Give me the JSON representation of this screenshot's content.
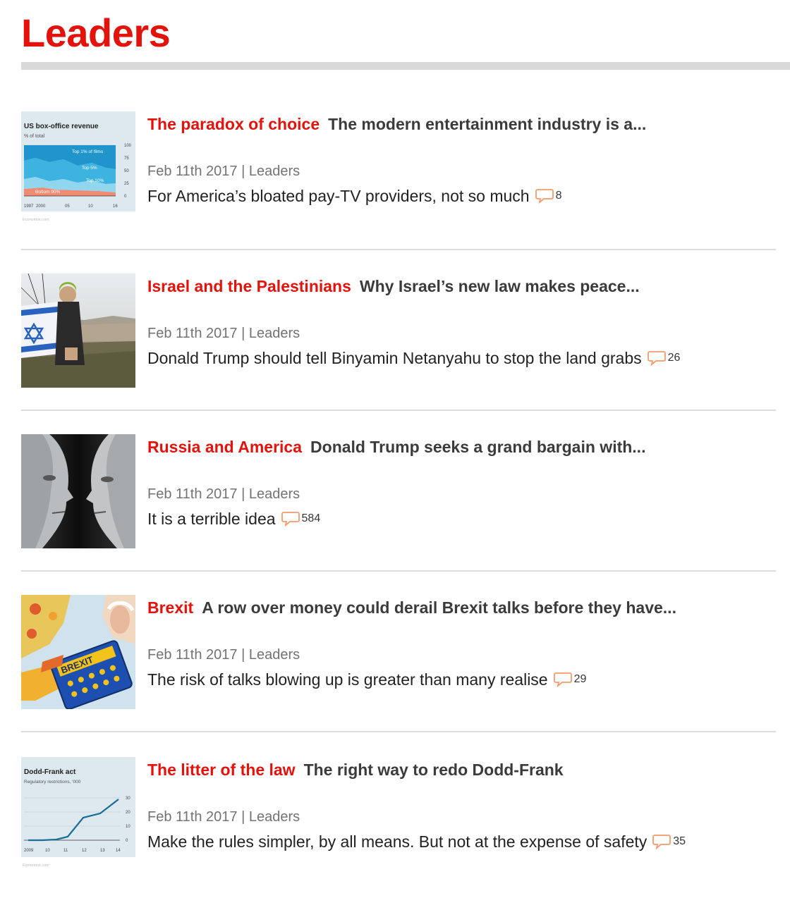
{
  "section": {
    "title": "Leaders"
  },
  "colors": {
    "accent": "#e3120b",
    "comment_icon": "#f29b6b",
    "meta": "#737373"
  },
  "articles": [
    {
      "fly_title": "The paradox of choice",
      "rubric": "The modern entertainment industry is a...",
      "date": "Feb 11th 2017",
      "separator": "|",
      "section": "Leaders",
      "description": "For America’s bloated pay-TV providers, not so much",
      "comments": "8",
      "thumbnail": {
        "type": "chart",
        "title": "US box-office revenue",
        "subtitle": "% of total",
        "labels": [
          "Top 1% of films",
          "Top 5%",
          "Top 10%",
          "Bottom 90%"
        ],
        "y_ticks": [
          "100",
          "75",
          "50",
          "25",
          "0"
        ],
        "x_ticks": [
          "1997",
          "2000",
          "05",
          "10",
          "16"
        ],
        "source": "Economist.com"
      }
    },
    {
      "fly_title": "Israel and the Palestinians",
      "rubric": "Why Israel’s new law makes peace...",
      "date": "Feb 11th 2017",
      "separator": "|",
      "section": "Leaders",
      "description": "Donald Trump should tell Binyamin Netanyahu to stop the land grabs",
      "comments": "26",
      "thumbnail": {
        "type": "photo",
        "icon": "flag-protester-photo"
      }
    },
    {
      "fly_title": "Russia and America",
      "rubric": "Donald Trump seeks a grand bargain with...",
      "date": "Feb 11th 2017",
      "separator": "|",
      "section": "Leaders",
      "description": "It is a terrible idea",
      "comments": "584",
      "thumbnail": {
        "type": "photo",
        "icon": "face-off-photo"
      }
    },
    {
      "fly_title": "Brexit",
      "rubric": "A row over money could derail Brexit talks before they have...",
      "date": "Feb 11th 2017",
      "separator": "|",
      "section": "Leaders",
      "description": "The risk of talks blowing up is greater than many realise",
      "comments": "29",
      "thumbnail": {
        "type": "illustration",
        "icon": "brexit-calculator-illustration",
        "label": "BREXIT"
      }
    },
    {
      "fly_title": "The litter of the law",
      "rubric": "The right way to redo Dodd-Frank",
      "date": "Feb 11th 2017",
      "separator": "|",
      "section": "Leaders",
      "description": "Make the rules simpler, by all means. But not at the expense of safety",
      "comments": "35",
      "thumbnail": {
        "type": "chart",
        "title": "Dodd-Frank act",
        "subtitle": "Regulatory restrictions, '000",
        "y_ticks": [
          "30",
          "20",
          "10",
          "0"
        ],
        "x_ticks": [
          "2009",
          "10",
          "11",
          "12",
          "13",
          "14"
        ],
        "source": "Economist.com"
      }
    }
  ]
}
